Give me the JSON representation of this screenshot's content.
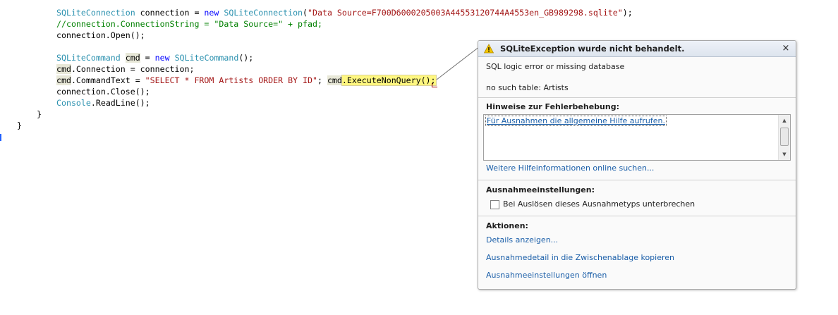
{
  "editor": {
    "lines": [
      [
        [
          "type",
          "SQLiteConnection"
        ],
        [
          "plain",
          " connection = "
        ],
        [
          "kw",
          "new"
        ],
        [
          "plain",
          " "
        ],
        [
          "type",
          "SQLiteConnection"
        ],
        [
          "plain",
          "("
        ],
        [
          "str",
          "\"Data Source=F700D6000205003A44553120744A4553en_GB989298.sqlite\""
        ],
        [
          "plain",
          ");"
        ]
      ],
      [
        [
          "comment",
          "//connection.ConnectionString = \"Data Source=\" + pfad;"
        ]
      ],
      [
        [
          "plain",
          "connection.Open();"
        ]
      ],
      [],
      [
        [
          "type",
          "SQLiteCommand"
        ],
        [
          "plain",
          " "
        ],
        [
          "ref",
          "cmd"
        ],
        [
          "plain",
          " = "
        ],
        [
          "kw",
          "new"
        ],
        [
          "plain",
          " "
        ],
        [
          "type",
          "SQLiteCommand"
        ],
        [
          "plain",
          "();"
        ]
      ],
      [
        [
          "ref",
          "cmd"
        ],
        [
          "plain",
          ".Connection = connection;"
        ]
      ],
      [
        [
          "ref",
          "cmd"
        ],
        [
          "plain",
          ".CommandText = "
        ],
        [
          "str",
          "\"SELECT * FROM Artists ORDER BY ID\""
        ],
        [
          "plain",
          "; "
        ],
        [
          "ref",
          "cmd"
        ],
        [
          "exec",
          ".ExecuteNonQuery();"
        ]
      ],
      [
        [
          "plain",
          "connection.Close();"
        ]
      ],
      [
        [
          "type",
          "Console"
        ],
        [
          "plain",
          ".ReadLine();"
        ]
      ],
      [
        [
          "plain",
          "}"
        ]
      ],
      [
        [
          "plain",
          "}"
        ]
      ]
    ]
  },
  "exception": {
    "title": "SQLiteException wurde nicht behandelt.",
    "close_glyph": "×",
    "message_line1": "SQL logic error or missing database",
    "message_line2": "no such table: Artists",
    "hints_heading": "Hinweise zur Fehlerbehebung:",
    "hint_link": "Für Ausnahmen die allgemeine Hilfe aufrufen.",
    "online_help_link": "Weitere Hilfeinformationen online suchen...",
    "settings_heading": "Ausnahmeeinstellungen:",
    "break_checkbox_label": "Bei Auslösen dieses Ausnahmetyps unterbrechen",
    "actions_heading": "Aktionen:",
    "actions": [
      "Details anzeigen...",
      "Ausnahmedetail in die Zwischenablage kopieren",
      "Ausnahmeeinstellungen öffnen"
    ]
  },
  "colors": {
    "keyword": "#0000ff",
    "type": "#2b91af",
    "string": "#a31515",
    "comment": "#008000",
    "link": "#1a5ea8",
    "warning": "#f3c500"
  },
  "icons": {
    "warning": "warning-icon",
    "close": "close-icon",
    "scroll_up": "scroll-up-arrow-icon",
    "scroll_down": "scroll-down-arrow-icon"
  }
}
